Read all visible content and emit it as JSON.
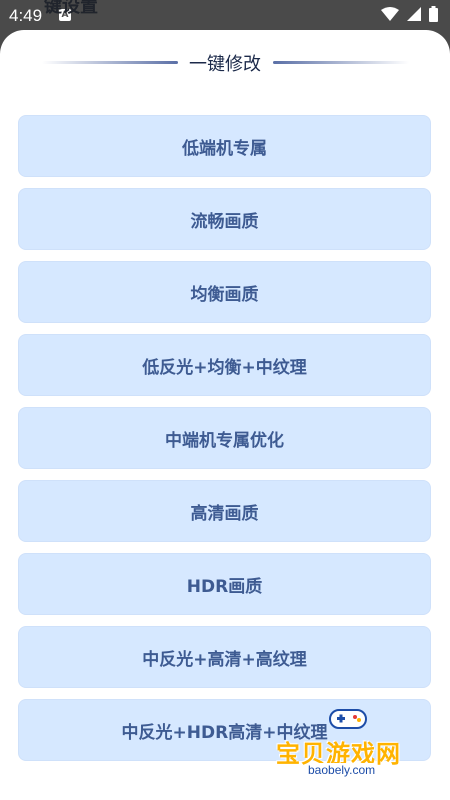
{
  "status_bar": {
    "time": "4:49",
    "notification_letter": "A"
  },
  "background_title": "键设置",
  "sheet": {
    "title": "一键修改",
    "options": [
      "低端机专属",
      "流畅画质",
      "均衡画质",
      "低反光+均衡+中纹理",
      "中端机专属优化",
      "高清画质",
      "HDR画质",
      "中反光+高清+高纹理",
      "中反光+HDR高清+中纹理"
    ]
  },
  "watermark": {
    "text": "宝贝游戏网",
    "url": "baobely.com"
  },
  "colors": {
    "button_bg": "#d6e8ff",
    "button_text": "#3e5b92",
    "title": "#1c2a4a"
  }
}
